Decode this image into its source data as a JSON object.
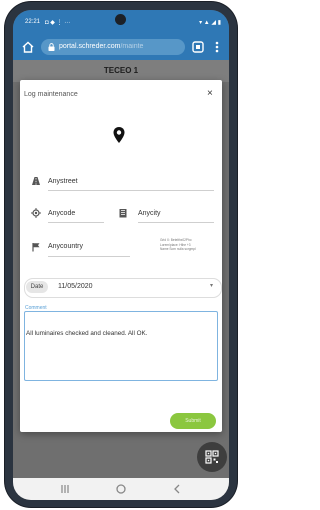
{
  "status_bar": {
    "time": "22:21",
    "icons": "◘ ◆ ⋮  ···",
    "right": "▾ ▲ ◢ ▮"
  },
  "browser": {
    "url_host": "portal.schreder.com",
    "url_path": "/mainte"
  },
  "app": {
    "title": "TECEO 1"
  },
  "dialog": {
    "title": "Log maintenance",
    "close": "×",
    "street": "Anystreet",
    "postcode": "Anycode",
    "city": "Anycity",
    "country": "Anycountry",
    "coords_note": "Grid X: Betelthx02Pho\nLorem/place: Hthe  +3\nName Som nulla sorgmpl",
    "date_label": "Date",
    "date_value": "11/05/2020",
    "comment_label": "Comment",
    "comment_value": "All luminaires checked and cleaned. All OK.",
    "submit_label": "Submit"
  },
  "colors": {
    "accent": "#2f78b5",
    "submit": "#8bc73f",
    "comment_border": "#7fb4e0"
  },
  "icons": [
    "home-icon",
    "lock-icon",
    "tabs-icon",
    "menu-icon",
    "map-pin-icon",
    "road-icon",
    "location-target-icon",
    "building-icon",
    "flag-icon",
    "qr-code-icon",
    "back-icon",
    "home-circle-icon",
    "recents-icon"
  ]
}
